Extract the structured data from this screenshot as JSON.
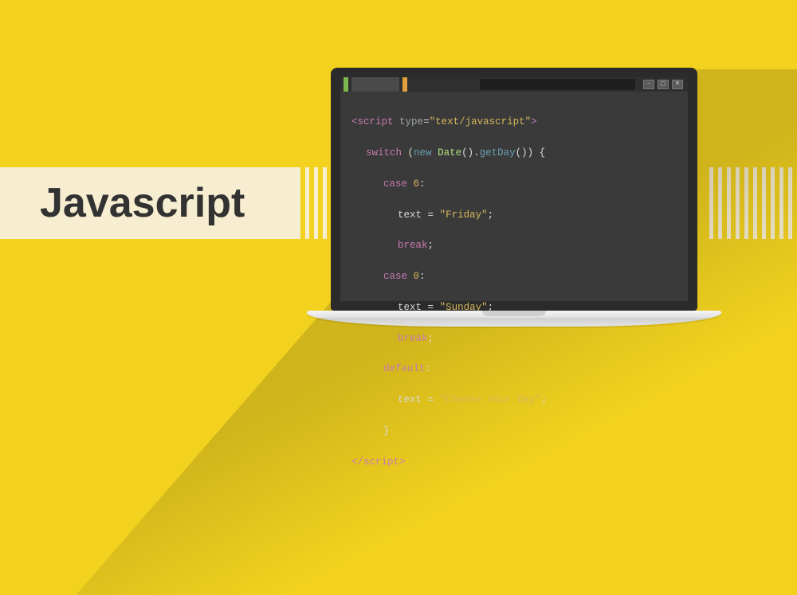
{
  "title": "Javascript",
  "code": {
    "script_open_tag": "script",
    "script_type_attr": "type",
    "script_type_val": "text/javascript",
    "switch_kw": "switch",
    "new_kw": "new",
    "date_type": "Date",
    "getday_fn": "getDay",
    "case_kw": "case",
    "case1_val": "6",
    "text_var": "text",
    "friday_str": "\"Friday\"",
    "break_kw": "break",
    "case2_val": "0",
    "sunday_str": "\"Sunday\"",
    "default_kw": "default",
    "choose_str": "\"Choose Your Day\"",
    "script_close_tag": "/script"
  },
  "window_controls": [
    "–",
    "◻",
    "✕"
  ]
}
